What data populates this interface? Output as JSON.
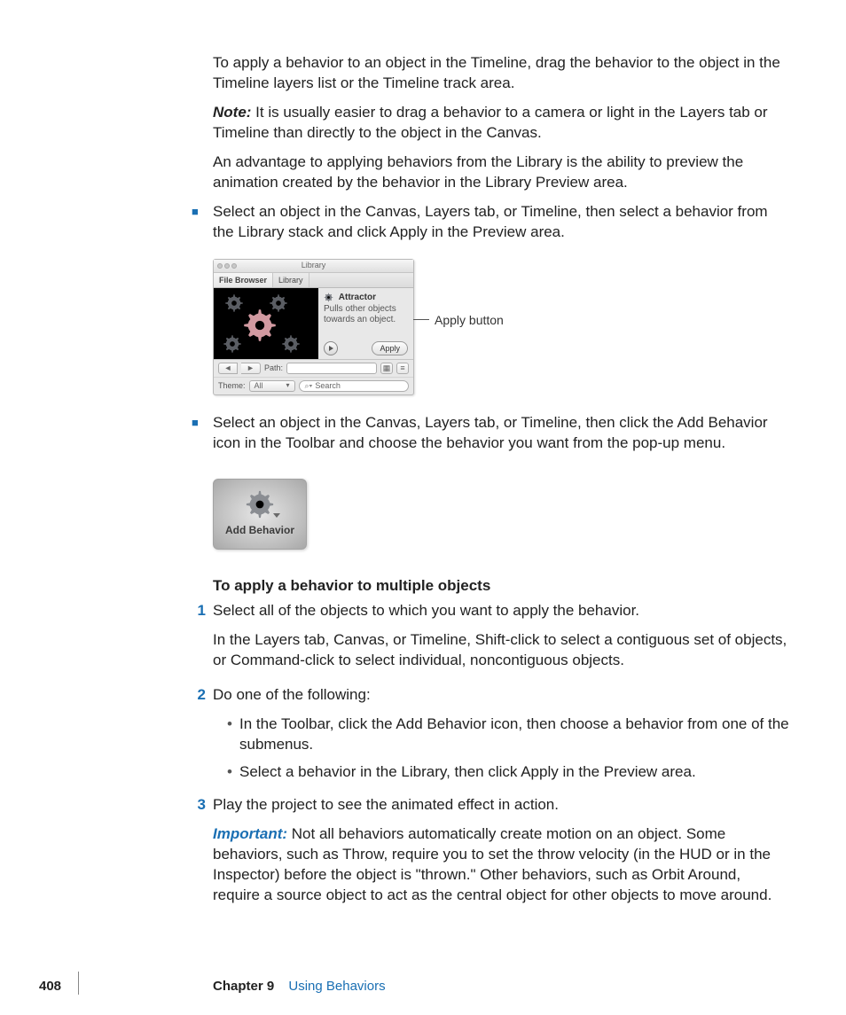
{
  "para_timeline": "To apply a behavior to an object in the Timeline, drag the behavior to the object in the Timeline layers list or the Timeline track area.",
  "note_label": "Note:",
  "note_text": " It is usually easier to drag a behavior to a camera or light in the Layers tab or Timeline than directly to the object in the Canvas.",
  "para_advantage": "An advantage to applying behaviors from the Library is the ability to preview the animation created by the behavior in the Library Preview area.",
  "bullet1": "Select an object in the Canvas, Layers tab, or Timeline, then select a behavior from the Library stack and click Apply in the Preview area.",
  "bullet2": "Select an object in the Canvas, Layers tab, or Timeline, then click the Add Behavior icon in the Toolbar and choose the behavior you want from the pop-up menu.",
  "library": {
    "title": "Library",
    "tab_filebrowser": "File Browser",
    "tab_library": "Library",
    "side_title": "Attractor",
    "side_desc": "Pulls other objects towards an object.",
    "apply": "Apply",
    "path_label": "Path:",
    "theme_label": "Theme:",
    "theme_value": "All",
    "search_placeholder": "Search"
  },
  "callout_apply": "Apply button",
  "add_behavior_label": "Add Behavior",
  "heading_multiple": "To apply a behavior to multiple objects",
  "steps": {
    "n1": "1",
    "s1a": "Select all of the objects to which you want to apply the behavior.",
    "s1b": "In the Layers tab, Canvas, or Timeline, Shift-click to select a contiguous set of objects, or Command-click to select individual, noncontiguous objects.",
    "n2": "2",
    "s2": "Do one of the following:",
    "s2a": "In the Toolbar, click the Add Behavior icon, then choose a behavior from one of the submenus.",
    "s2b": "Select a behavior in the Library, then click Apply in the Preview area.",
    "n3": "3",
    "s3": "Play the project to see the animated effect in action."
  },
  "important_label": "Important:",
  "important_text": " Not all behaviors automatically create motion on an object. Some behaviors, such as Throw, require you to set the throw velocity (in the HUD or in the Inspector) before the object is \"thrown.\" Other behaviors, such as Orbit Around, require a source object to act as the central object for other objects to move around.",
  "footer": {
    "page": "408",
    "chapter_num": "Chapter 9",
    "chapter_title": "Using Behaviors"
  }
}
